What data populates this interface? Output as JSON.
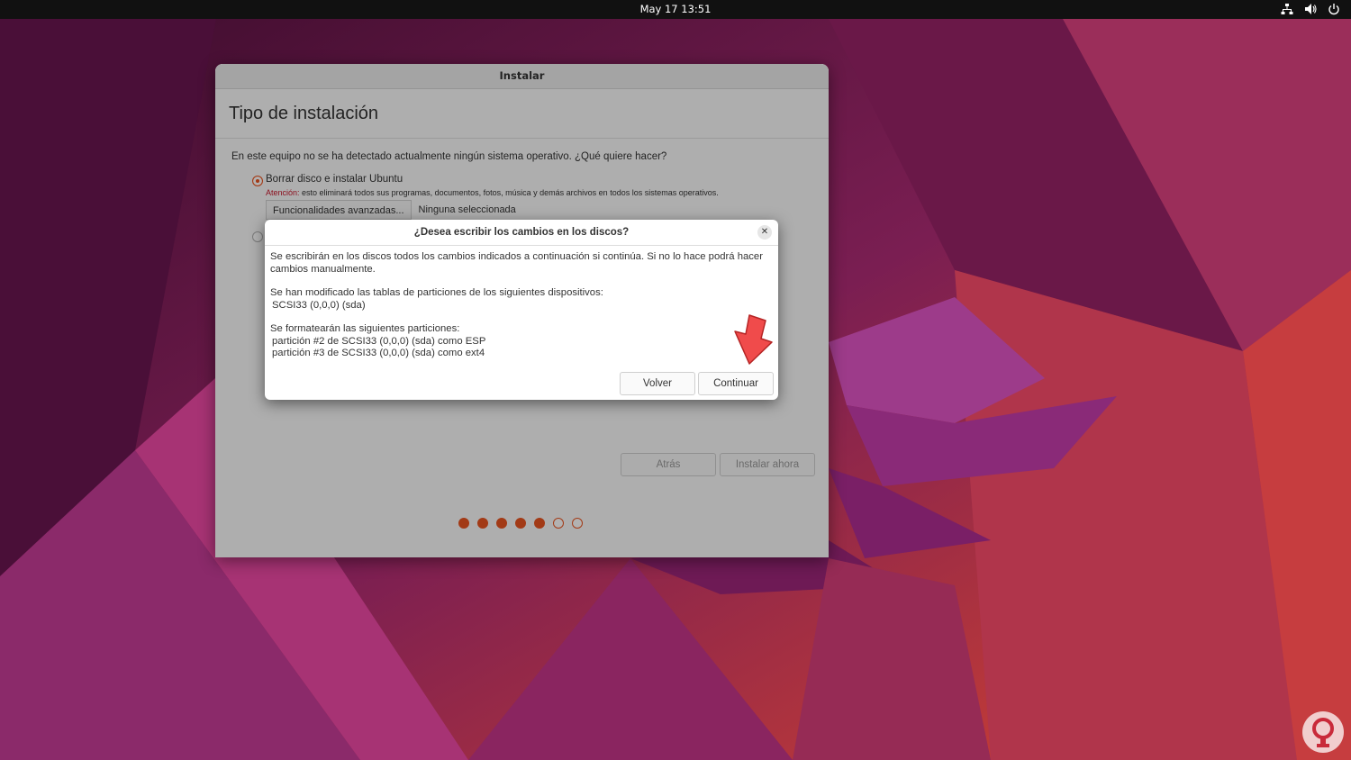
{
  "topbar": {
    "clock": "May 17  13:51",
    "tray_icons": [
      "network-icon",
      "volume-icon",
      "power-icon"
    ]
  },
  "installer": {
    "window_title": "Instalar",
    "heading": "Tipo de instalación",
    "question": "En este equipo no se ha detectado actualmente ningún sistema operativo. ¿Qué quiere hacer?",
    "option_erase": {
      "label": "Borrar disco e instalar Ubuntu",
      "selected": true,
      "warning_prefix": "Atención:",
      "warning_text": " esto eliminará todos sus programas, documentos, fotos, música y demás archivos en todos los sistemas operativos."
    },
    "advanced": {
      "button_label": "Funcionalidades avanzadas...",
      "value": "Ninguna seleccionada"
    },
    "option_other": {
      "selected": false
    },
    "back_button": "Atrás",
    "install_button": "Instalar ahora",
    "progress": {
      "total_steps": 7,
      "completed_steps": 5
    }
  },
  "dialog": {
    "title": "¿Desea escribir los cambios en los discos?",
    "line1": "Se escribirán en los discos todos los cambios indicados a continuación si continúa. Si no lo hace podrá hacer cambios manualmente.",
    "line2": "Se han modificado las tablas de particiones de los siguientes dispositivos:",
    "device": " SCSI33 (0,0,0) (sda)",
    "line3": "Se formatearán las siguientes particiones:",
    "partition1": " partición #2 de SCSI33 (0,0,0) (sda) como ESP",
    "partition2": " partición #3 de SCSI33 (0,0,0) (sda) como ext4",
    "back_button": "Volver",
    "continue_button": "Continuar"
  },
  "colors": {
    "accent": "#e95420",
    "warning": "#c7162b",
    "arrow": "#f04b4b",
    "topbar": "#111111"
  }
}
